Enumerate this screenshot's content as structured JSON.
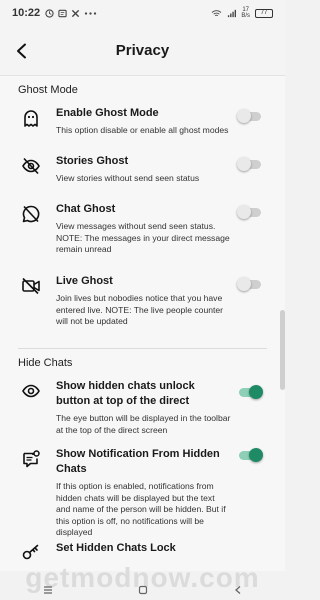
{
  "status_bar": {
    "time": "10:22",
    "speed_top": "17",
    "speed_bottom": "B/s",
    "battery": "77",
    "icons": [
      "clock-icon",
      "message-icon",
      "x-icon",
      "more-dots-icon"
    ]
  },
  "app_bar": {
    "title": "Privacy",
    "back_icon": "back-arrow-icon"
  },
  "sections": {
    "ghost": {
      "header": "Ghost Mode",
      "items": [
        {
          "title": "Enable Ghost Mode",
          "desc": "This option disable or enable all ghost modes",
          "enabled": false,
          "icon": "ghost-icon"
        },
        {
          "title": "Stories Ghost",
          "desc": "View stories without send seen status",
          "enabled": false,
          "icon": "eye-off-icon"
        },
        {
          "title": "Chat Ghost",
          "desc": "View messages without send seen status. NOTE: The messages in your direct message remain unread",
          "enabled": false,
          "icon": "chat-off-icon"
        },
        {
          "title": "Live Ghost",
          "desc": "Join lives but nobodies notice that you have entered live. NOTE: The live people counter will not be updated",
          "enabled": false,
          "icon": "video-off-icon"
        }
      ]
    },
    "hide": {
      "header": "Hide Chats",
      "items": [
        {
          "title": "Show hidden chats unlock button at top of the direct",
          "desc": "The eye button will be displayed in the toolbar at the top of the direct screen",
          "enabled": true,
          "icon": "eye-icon"
        },
        {
          "title": "Show Notification From Hidden Chats",
          "desc": "If this option is enabled, notifications from hidden chats will be displayed but the text and name of the person will be hidden. But if this option is off, no notifications will be displayed",
          "enabled": true,
          "icon": "chat-notification-icon"
        },
        {
          "title": "Set Hidden Chats Lock",
          "icon": "key-icon"
        }
      ]
    }
  },
  "watermark": "getmodnow.com",
  "colors": {
    "accent": "#1e8a66",
    "accent_track": "#8ecfb7",
    "toggle_off": "#cfcfcf"
  }
}
